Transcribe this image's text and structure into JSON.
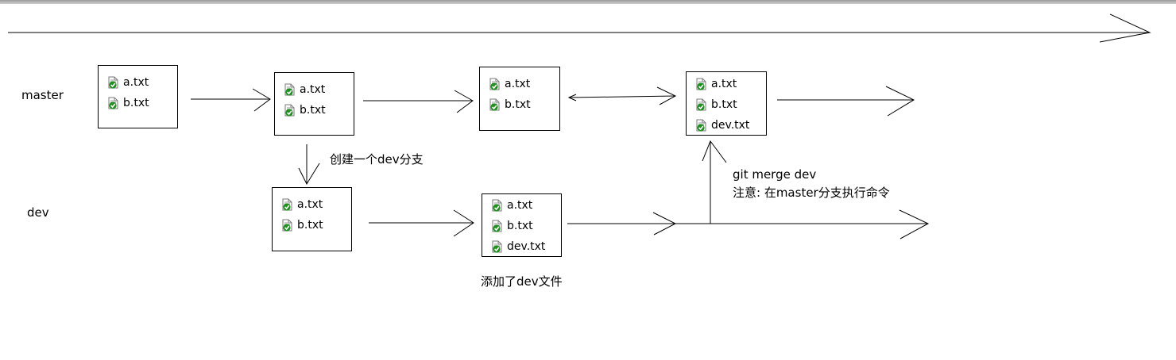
{
  "branches": {
    "master": "master",
    "dev": "dev"
  },
  "boxes": {
    "m1": [
      "a.txt",
      "b.txt"
    ],
    "m2": [
      "a.txt",
      "b.txt"
    ],
    "m3": [
      "a.txt",
      "b.txt"
    ],
    "m4": [
      "a.txt",
      "b.txt",
      "dev.txt"
    ],
    "d1": [
      "a.txt",
      "b.txt"
    ],
    "d2": [
      "a.txt",
      "b.txt",
      "dev.txt"
    ]
  },
  "annotations": {
    "create_branch": "创建一个dev分支",
    "added_file": "添加了dev文件",
    "merge_cmd": "git merge dev",
    "merge_note": "注意: 在master分支执行命令"
  },
  "colors": {
    "stroke": "#000000",
    "icon_check": "#1f8f1f",
    "icon_page": "#ffffff"
  },
  "icons": {
    "file": "checked-file-icon"
  }
}
